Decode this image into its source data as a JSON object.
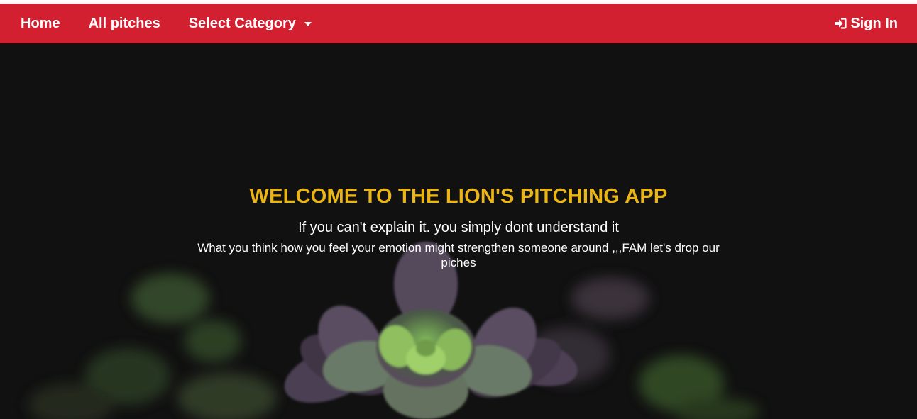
{
  "nav": {
    "home": "Home",
    "all_pitches": "All pitches",
    "select_category": "Select Category",
    "sign_in": "Sign In"
  },
  "hero": {
    "title": "WELCOME TO THE LION'S PITCHING APP",
    "subtitle": "If you can't explain it. you simply dont understand it",
    "description": "What you think how you feel your emotion might strengthen someone around ,,,FAM let's drop our piches"
  },
  "colors": {
    "navbar": "#d32030",
    "title": "#eab515",
    "hero_background": "#111111"
  },
  "icons": {
    "sign_in": "sign-in-icon",
    "dropdown": "caret-down-icon"
  }
}
